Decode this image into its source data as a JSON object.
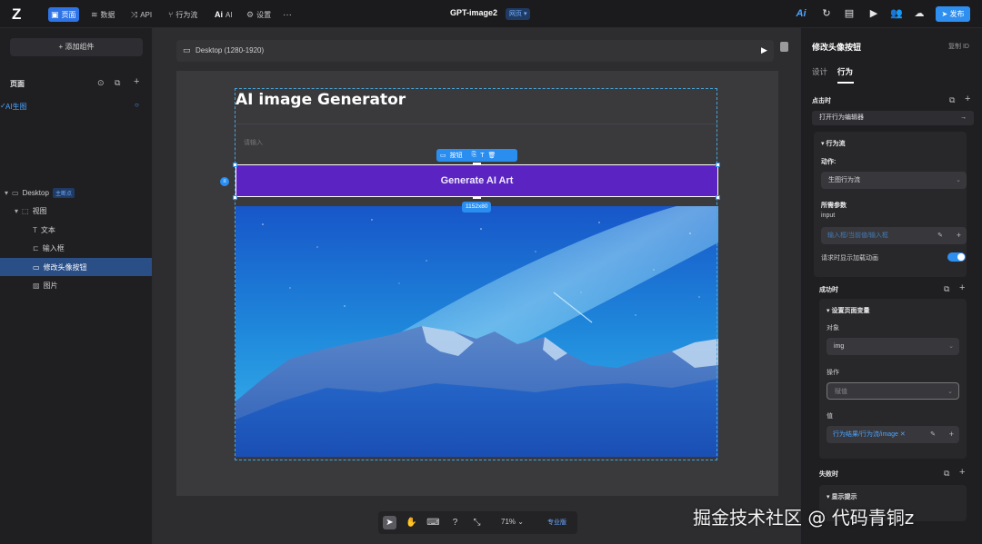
{
  "topbar": {
    "logo": "Z",
    "nav": [
      {
        "label": "页面",
        "icon": "page-icon",
        "active": true
      },
      {
        "label": "数据",
        "icon": "database-icon",
        "active": false
      },
      {
        "label": "API",
        "icon": "api-icon",
        "active": false
      },
      {
        "label": "行为流",
        "icon": "flow-icon",
        "active": false
      },
      {
        "label": "AI",
        "icon": "ai-icon",
        "active": false
      },
      {
        "label": "设置",
        "icon": "gear-icon",
        "active": false
      }
    ],
    "more": "···",
    "project_title": "GPT-image2",
    "title_badge": "网页",
    "ai_label": "Ai",
    "publish_label": "发布"
  },
  "left": {
    "add_component": "+ 添加组件",
    "pages_title": "页面",
    "page_item": "AI生图",
    "tree": [
      {
        "label": "Desktop",
        "tag": "主断点",
        "icon": "desktop-icon",
        "indent": 0
      },
      {
        "label": "视图",
        "icon": "view-icon",
        "indent": 1
      },
      {
        "label": "文本",
        "icon": "text-icon",
        "indent": 2
      },
      {
        "label": "输入框",
        "icon": "input-icon",
        "indent": 2
      },
      {
        "label": "修改头像按钮",
        "icon": "button-icon",
        "indent": 2,
        "selected": true
      },
      {
        "label": "图片",
        "icon": "image-icon",
        "indent": 2
      }
    ]
  },
  "canvas": {
    "device_label": "Desktop (1280-1920)",
    "app_title": "AI image Generator",
    "input_placeholder": "请输入",
    "button_label": "Generate AI Art",
    "toolbar_label": "按钮",
    "size_label": "1152x80",
    "zoom": "71%",
    "plan": "专业版"
  },
  "right": {
    "title": "修改头像按钮",
    "copy_id": "复制 ID",
    "tabs": [
      "设计",
      "行为"
    ],
    "on_click": "点击时",
    "open_editor": "打开行为编辑器",
    "flow_title": "行为流",
    "action_label": "动作:",
    "action_value": "生图行为流",
    "params_label": "所需参数",
    "param_name": "input",
    "param_value": "输入框/当前值/输入框",
    "loading_label": "请求时显示加载动画",
    "loading_on": true,
    "on_success": "成功时",
    "set_var": "设置页面变量",
    "target_label": "对象",
    "target_value": "img",
    "op_label": "操作",
    "op_value": "赋值",
    "value_label": "值",
    "value_value": "行为结果/行为流/image",
    "on_fail": "失败时",
    "show_tip": "显示提示"
  },
  "colors": {
    "accent": "#2f8ff0",
    "button": "#5b24c2",
    "selection": "#2a4e86"
  },
  "watermark": "掘金技术社区 @ 代码青铜z"
}
